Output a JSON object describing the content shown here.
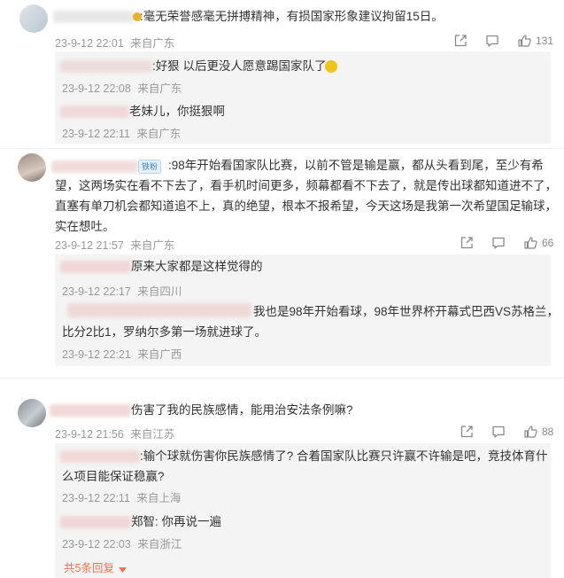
{
  "comments": [
    {
      "text": ":毫无荣誉感毫无拼搏精神，有损国家形象建议拘留15日。",
      "time": "23-9-12 22:01",
      "location": "来自广东",
      "likes": "131",
      "replies": [
        {
          "text": ":好狠 以后更没人愿意踢国家队了",
          "time": "23-9-12 22:08",
          "location": "来自广东"
        },
        {
          "text": "老妹儿，你挺狠啊",
          "time": "23-9-12 22:11",
          "location": "来自广东"
        }
      ]
    },
    {
      "badge": "铁粉",
      "text_lines": [
        ":98年开始看国家队比赛，以前不管是输是赢，都从头看到尾，至少有希",
        "望，这两场实在看不下去了，看手机时间更多，频幕都看不下去了，就是传出球都知道进不了，",
        "直塞有单刀机会都知道追不上，真的绝望，根本不报希望，今天这场是我第一次希望国足输球，",
        "实在想吐。"
      ],
      "time": "23-9-12 21:57",
      "location": "来自广东",
      "likes": "66",
      "replies": [
        {
          "text": "原来大家都是这样觉得的",
          "time": "23-9-12 22:17",
          "location": "来自四川"
        },
        {
          "text_lines": [
            "我也是98年开始看球，98年世界杯开幕式巴西VS苏格兰，",
            "比分2比1，罗纳尔多第一场就进球了。"
          ],
          "time": "23-9-12 22:21",
          "location": "来自广西"
        }
      ]
    },
    {
      "text": "伤害了我的民族感情，能用治安法条例嘛?",
      "time": "23-9-12 21:56",
      "location": "来自江苏",
      "likes": "88",
      "replies": [
        {
          "text_lines": [
            ":输个球就伤害你民族感情了? 合着国家队比赛只许赢不许输是吧，竞技体育什",
            "么项目能保证稳赢?"
          ],
          "time": "23-9-12 22:11",
          "location": "来自上海"
        },
        {
          "text": "郑智: 你再说一遍",
          "time": "23-9-12 22:03",
          "location": "来自浙江"
        }
      ],
      "more": "共5条回复"
    }
  ],
  "colors": {
    "link": "#eb7350",
    "meta": "#999999",
    "reply_bg": "#f4f4f4"
  },
  "icons": [
    "share-icon",
    "comment-icon",
    "like-icon",
    "chevron-down-icon"
  ]
}
